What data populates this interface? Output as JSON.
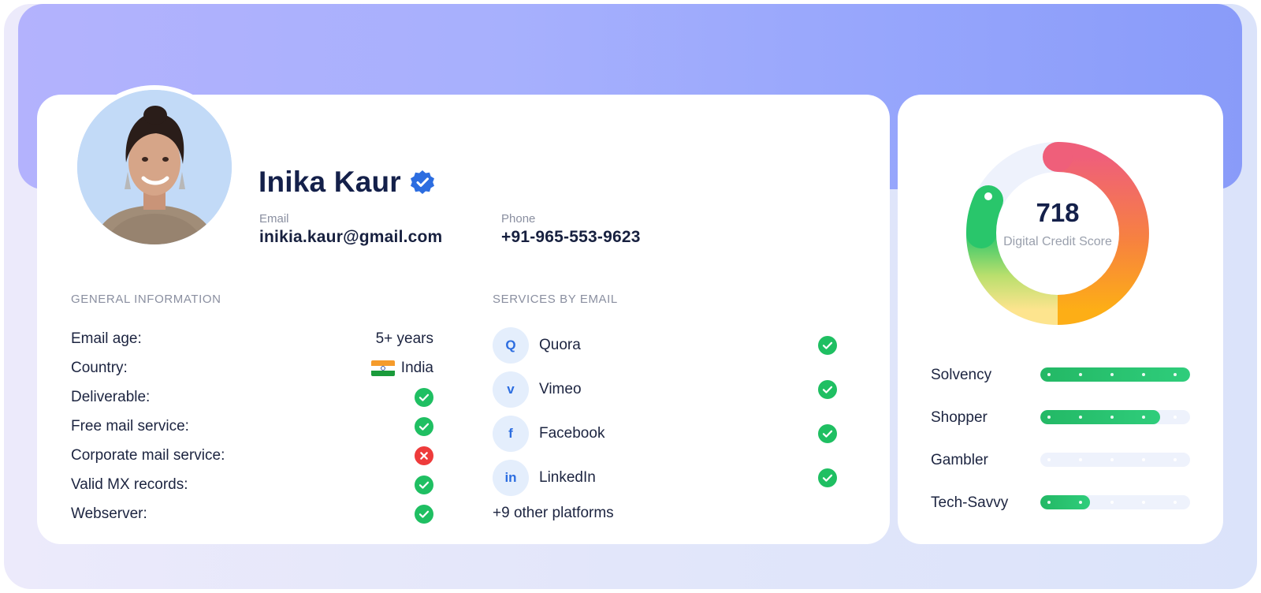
{
  "profile": {
    "name": "Inika Kaur",
    "email_label": "Email",
    "email": "inikia.kaur@gmail.com",
    "phone_label": "Phone",
    "phone": "+91-965-553-9623"
  },
  "general_information": {
    "title": "GENERAL INFORMATION",
    "rows": [
      {
        "label": "Email age:",
        "value": "5+ years"
      },
      {
        "label": "Country:",
        "value": "India",
        "flag": "india-flag-icon"
      },
      {
        "label": "Deliverable:",
        "status": "yes"
      },
      {
        "label": "Free mail service:",
        "status": "yes"
      },
      {
        "label": "Corporate mail service:",
        "status": "no"
      },
      {
        "label": "Valid MX records:",
        "status": "yes"
      },
      {
        "label": "Webserver:",
        "status": "yes"
      }
    ]
  },
  "services_by_email": {
    "title": "SERVICES BY EMAIL",
    "items": [
      {
        "name": "Quora",
        "glyph": "Q",
        "icon": "quora-icon",
        "status": "yes"
      },
      {
        "name": "Vimeo",
        "glyph": "v",
        "icon": "vimeo-icon",
        "status": "yes"
      },
      {
        "name": "Facebook",
        "glyph": "f",
        "icon": "facebook-icon",
        "status": "yes"
      },
      {
        "name": "LinkedIn",
        "glyph": "in",
        "icon": "linkedin-icon",
        "status": "yes"
      }
    ],
    "more": "+9 other platforms"
  },
  "credit": {
    "score": "718",
    "score_label": "Digital Credit Score",
    "traits": [
      {
        "label": "Solvency",
        "level": 1.0
      },
      {
        "label": "Shopper",
        "level": 0.8
      },
      {
        "label": "Gambler",
        "level": 0.0
      },
      {
        "label": "Tech-Savvy",
        "level": 0.33
      }
    ]
  },
  "colors": {
    "accent_blue": "#2c6de0",
    "success": "#1fbf62",
    "error": "#ee3b3b",
    "banner_start": "#b3b2fd",
    "banner_end": "#899bf9",
    "bar_fill": "#23b865"
  }
}
